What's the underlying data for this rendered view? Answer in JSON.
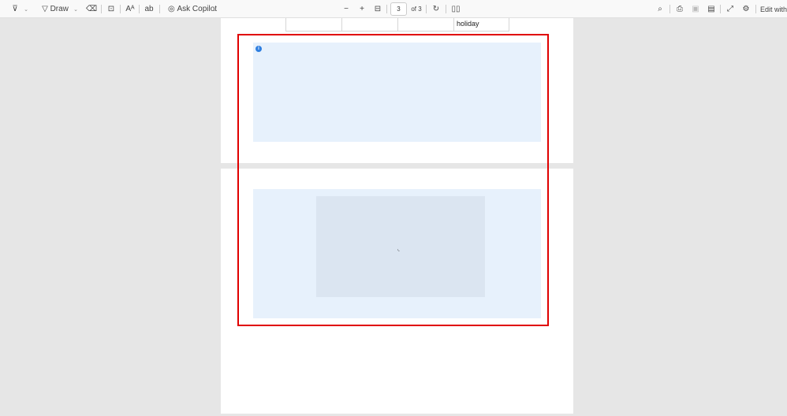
{
  "toolbar": {
    "highlight_icon": "highlighter-icon",
    "draw_label": "Draw",
    "ask_copilot_label": "Ask Copilot",
    "zoom_out": "−",
    "zoom_in": "+",
    "current_page": "3",
    "page_total": "of 3",
    "edit_with_label": "Edit with"
  },
  "document": {
    "table_row": [
      "",
      "",
      "",
      "holiday"
    ]
  }
}
